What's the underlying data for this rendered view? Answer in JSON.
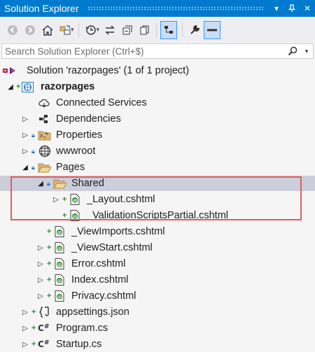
{
  "window": {
    "title": "Solution Explorer",
    "buttons": [
      {
        "icon": "dropdown-arrow-icon",
        "glyph": "▾"
      },
      {
        "icon": "pin-icon",
        "glyph": "🖈"
      },
      {
        "icon": "close-icon",
        "glyph": "✕"
      }
    ]
  },
  "toolbar": {
    "items": [
      "back-icon",
      "forward-icon",
      "home-icon",
      "switch-views-icon",
      "history-icon",
      "sync-icon",
      "collapse-all-icon",
      "copy-icon",
      "show-all-files-icon",
      "properties-wrench-icon",
      "preview-selected-icon"
    ]
  },
  "search": {
    "placeholder": "Search Solution Explorer (Ctrl+$)"
  },
  "tree": {
    "solution": "Solution 'razorpages' (1 of 1 project)",
    "project": "razorpages",
    "items": {
      "connected_services": "Connected Services",
      "dependencies": "Dependencies",
      "properties": "Properties",
      "wwwroot": "wwwroot",
      "pages": "Pages",
      "shared": "Shared",
      "layout": "_Layout.cshtml",
      "validation": "_ValidationScriptsPartial.cshtml",
      "viewimports": "_ViewImports.cshtml",
      "viewstart": "_ViewStart.cshtml",
      "error": "Error.cshtml",
      "index": "Index.cshtml",
      "privacy": "Privacy.cshtml",
      "appsettings": "appsettings.json",
      "program": "Program.cs",
      "startup": "Startup.cs"
    }
  },
  "colors": {
    "titlebar": "#007acc",
    "selection": "#cccedb",
    "highlight_box": "#e25d5d",
    "git_plus": "#388a34",
    "lock": "#1e78c8"
  }
}
